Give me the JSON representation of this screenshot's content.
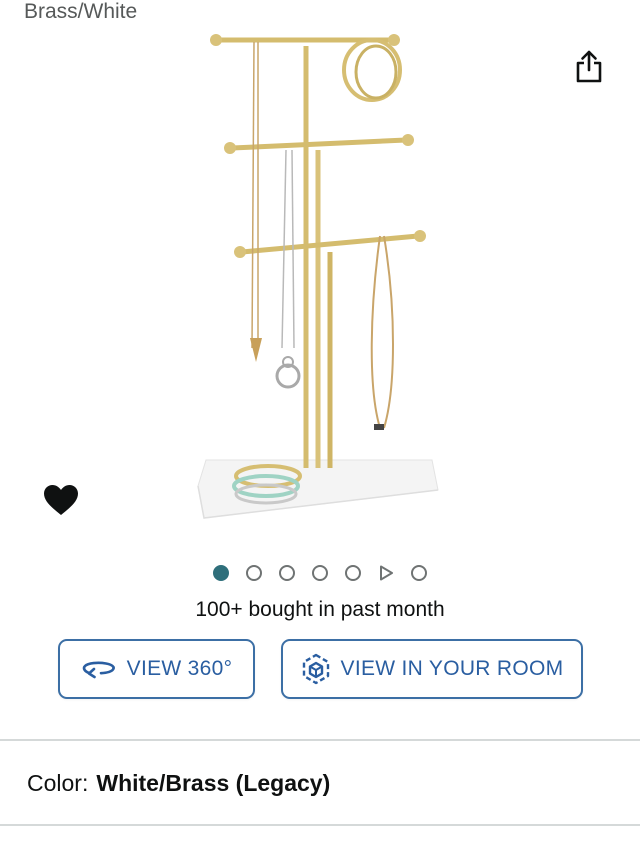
{
  "variant": {
    "label": "Brass/White"
  },
  "colors": {
    "accent": "#2a5ea1",
    "dot_active": "#2f6f7b",
    "brass": "#d9c27a"
  },
  "icons": {
    "share": "share-icon",
    "favorite": "heart-icon",
    "rotate": "rotate-360-icon",
    "ar": "cube-ar-icon",
    "video": "play-icon"
  },
  "carousel": {
    "active_index": 0,
    "item_count": 7,
    "video_index": 5
  },
  "social_proof": {
    "text": "100+ bought in past month"
  },
  "actions": {
    "view_360_label": "VIEW 360°",
    "view_room_label": "VIEW IN YOUR ROOM"
  },
  "color_selector": {
    "label": "Color:",
    "value": "White/Brass (Legacy)"
  }
}
